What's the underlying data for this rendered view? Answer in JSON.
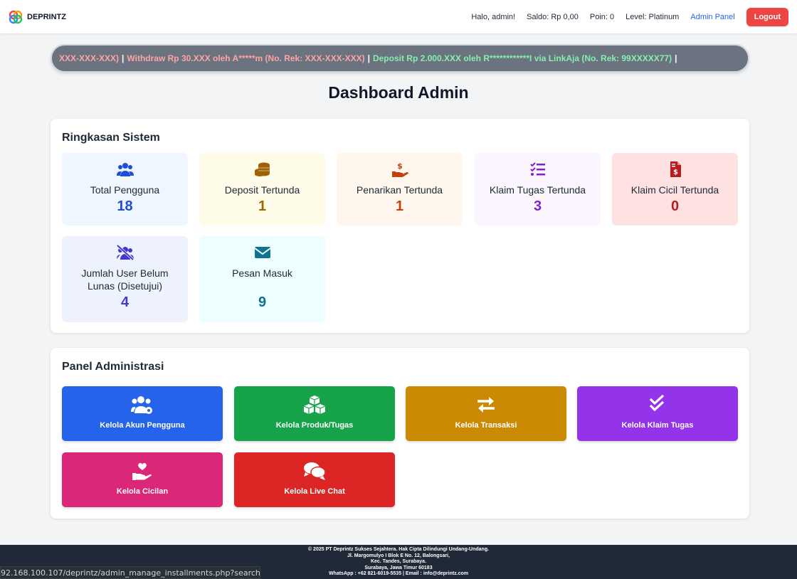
{
  "header": {
    "brand": "DEPRINTZ",
    "greeting": "Halo, admin!",
    "saldo": "Saldo: Rp 0,00",
    "poin": "Poin: 0",
    "level": "Level: Platinum",
    "admin_panel": "Admin Panel",
    "logout": "Logout"
  },
  "ticker": {
    "items": [
      {
        "text": "XXX-XXX-XXX)",
        "kind": "withdraw"
      },
      {
        "text": "Withdraw Rp 30.XXX oleh A*****m (No. Rek: XXX-XXX-XXX)",
        "kind": "withdraw"
      },
      {
        "text": "Deposit Rp 2.000.XXX oleh R************I via LinkAja (No. Rek: 99XXXXX77)",
        "kind": "deposit"
      }
    ],
    "separator": "|"
  },
  "page_title": "Dashboard Admin",
  "summary": {
    "title": "Ringkasan Sistem",
    "stats": [
      {
        "label": "Total Pengguna",
        "value": "18",
        "icon": "users-icon",
        "bg": "#eff6ff",
        "color": "#1d4ed8"
      },
      {
        "label": "Deposit Tertunda",
        "value": "1",
        "icon": "coins-icon",
        "bg": "#fefce8",
        "color": "#a16207"
      },
      {
        "label": "Penarikan Tertunda",
        "value": "1",
        "icon": "hand-dollar-icon",
        "bg": "#fff7ed",
        "color": "#c2410c"
      },
      {
        "label": "Klaim Tugas Tertunda",
        "value": "3",
        "icon": "checklist-icon",
        "bg": "#faf5ff",
        "color": "#7e22ce"
      },
      {
        "label": "Klaim Cicil Tertunda",
        "value": "0",
        "icon": "invoice-dollar-icon",
        "bg": "#fee2e2",
        "color": "#b91c1c"
      },
      {
        "label": "Jumlah User Belum Lunas (Disetujui)",
        "value": "4",
        "icon": "users-slash-icon",
        "bg": "#eef2ff",
        "color": "#4338ca"
      },
      {
        "label": "Pesan Masuk",
        "value": "9",
        "icon": "envelope-icon",
        "bg": "#ecfeff",
        "color": "#0e7490"
      }
    ]
  },
  "admin_panel": {
    "title": "Panel Administrasi",
    "buttons": [
      {
        "label": "Kelola Akun Pengguna",
        "icon": "users-cog-icon",
        "color": "#2563eb"
      },
      {
        "label": "Kelola Produk/Tugas",
        "icon": "cubes-icon",
        "color": "#16a34a"
      },
      {
        "label": "Kelola Transaksi",
        "icon": "exchange-icon",
        "color": "#ca8a04"
      },
      {
        "label": "Kelola Klaim Tugas",
        "icon": "double-check-icon",
        "color": "#9333ea"
      },
      {
        "label": "Kelola Cicilan",
        "icon": "hand-heart-icon",
        "color": "#db2777"
      },
      {
        "label": "Kelola Live Chat",
        "icon": "comments-icon",
        "color": "#dc2626"
      }
    ]
  },
  "footer": {
    "line1": "© 2025 PT Deprintz Sukses Sejahtera. Hak Cipta Dilindungi Undang-Undang.",
    "line2": "Jl. Margomulyo I Blok E No. 12, Balongsari,",
    "line3": "Kec. Tandes, Surabaya.",
    "line4": "Surabaya, Jawa Timur 60183",
    "line5": "WhatsApp : +62 821-6019-5535 | Email : info@deprintz.com"
  },
  "status_url": "92.168.100.107/deprintz/admin_manage_installments.php?search=..."
}
